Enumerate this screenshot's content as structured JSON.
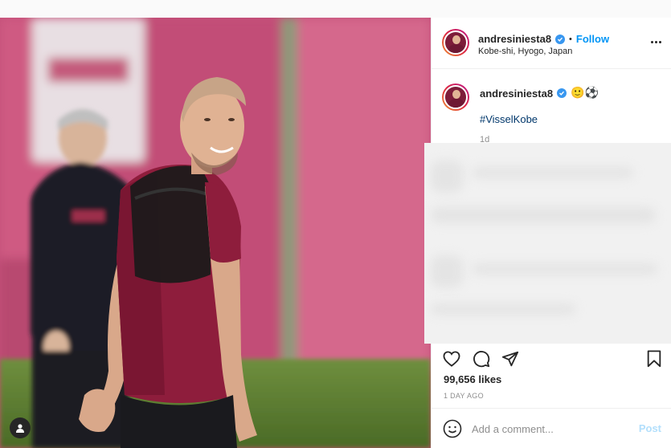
{
  "post": {
    "username": "andresiniesta8",
    "follow_label": "Follow",
    "separator": "•",
    "location": "Kobe-shi, Hyogo, Japan",
    "caption_emojis": "🙂⚽",
    "hashtag": "#VisselKobe",
    "age": "1d",
    "likes": "99,656 likes",
    "posted_time": "1 DAY AGO"
  },
  "comment": {
    "placeholder": "Add a comment...",
    "post_label": "Post"
  },
  "icons": {
    "verified": "verified-badge-icon",
    "more": "more-options-icon",
    "like": "heart-icon",
    "comment": "comment-icon",
    "share": "paper-plane-icon",
    "save": "bookmark-icon",
    "emoji": "smiley-icon",
    "tag": "user-tag-icon"
  },
  "colors": {
    "accent": "#0095f6",
    "hashtag": "#00376b",
    "post_disabled": "#b2dffc",
    "verified": "#3897f0"
  }
}
